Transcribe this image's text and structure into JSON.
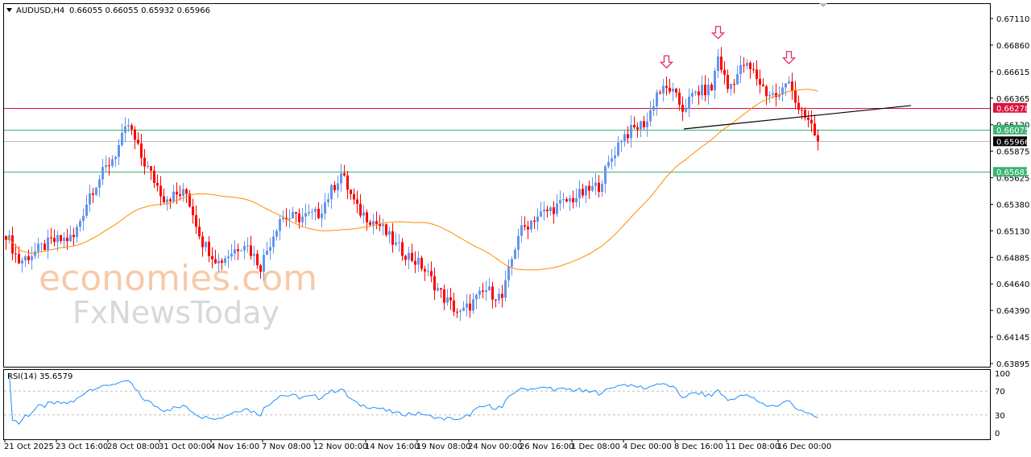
{
  "header": {
    "symbol": "AUDUSD,H4",
    "ohlc": "0.66055 0.66055 0.65932 0.65966"
  },
  "rsi": {
    "label": "RSI(14) 35.6579",
    "levels": [
      30,
      70
    ],
    "ticks": [
      "100",
      "70",
      "30",
      "0"
    ]
  },
  "watermark": {
    "line1": "economies.com",
    "line2": "FxNewsToday"
  },
  "colors": {
    "bull": "#6495ED",
    "bear": "#FF0000",
    "ma": "#FF8C00",
    "resistance": "#DC143C",
    "support": "#3CB371",
    "current": "#000000",
    "rsi": "#1E90FF"
  },
  "chart_data": {
    "type": "candlestick",
    "title": "AUDUSD,H4",
    "ylim": [
      0.63895,
      0.6711
    ],
    "y_ticks": [
      "0.67110",
      "0.66860",
      "0.66615",
      "0.66365",
      "0.66120",
      "0.65875",
      "0.65625",
      "0.65380",
      "0.65130",
      "0.64885",
      "0.64640",
      "0.64390",
      "0.64145",
      "0.63895"
    ],
    "x_ticks": [
      "21 Oct 2025",
      "23 Oct 16:00",
      "28 Oct 08:00",
      "31 Oct 00:00",
      "4 Nov 16:00",
      "7 Nov 08:00",
      "12 Nov 00:00",
      "14 Nov 16:00",
      "19 Nov 08:00",
      "24 Nov 00:00",
      "26 Nov 16:00",
      "1 Dec 08:00",
      "4 Dec 00:00",
      "8 Dec 16:00",
      "11 Dec 08:00",
      "16 Dec 00:00"
    ],
    "bars_per_tick": 16,
    "price_path": [
      [
        0,
        0.65105
      ],
      [
        4,
        0.64842
      ],
      [
        14,
        0.65029
      ],
      [
        21,
        0.65067
      ],
      [
        26,
        0.6548
      ],
      [
        34,
        0.65856
      ],
      [
        38,
        0.66119
      ],
      [
        42,
        0.65818
      ],
      [
        49,
        0.65443
      ],
      [
        56,
        0.6548
      ],
      [
        61,
        0.65029
      ],
      [
        66,
        0.64842
      ],
      [
        74,
        0.65029
      ],
      [
        79,
        0.64804
      ],
      [
        85,
        0.65255
      ],
      [
        91,
        0.65255
      ],
      [
        97,
        0.65292
      ],
      [
        104,
        0.65668
      ],
      [
        109,
        0.6533
      ],
      [
        116,
        0.6518
      ],
      [
        121,
        0.64992
      ],
      [
        129,
        0.64804
      ],
      [
        136,
        0.64504
      ],
      [
        141,
        0.64354
      ],
      [
        149,
        0.64579
      ],
      [
        154,
        0.64504
      ],
      [
        159,
        0.65105
      ],
      [
        164,
        0.65255
      ],
      [
        174,
        0.65405
      ],
      [
        184,
        0.65555
      ],
      [
        191,
        0.66006
      ],
      [
        199,
        0.66156
      ],
      [
        202,
        0.66419
      ],
      [
        206,
        0.66457
      ],
      [
        210,
        0.66269
      ],
      [
        214,
        0.66419
      ],
      [
        219,
        0.66457
      ],
      [
        221,
        0.66757
      ],
      [
        224,
        0.66457
      ],
      [
        229,
        0.66682
      ],
      [
        232,
        0.66607
      ],
      [
        236,
        0.66419
      ],
      [
        240,
        0.66381
      ],
      [
        243,
        0.66569
      ],
      [
        246,
        0.66231
      ],
      [
        249,
        0.66156
      ],
      [
        251,
        0.66043
      ],
      [
        252,
        0.65966
      ]
    ],
    "last_close": 0.65966,
    "moving_average": {
      "period": 50
    },
    "horizontal_levels": [
      {
        "price": 0.66278,
        "label": "0.66278",
        "kind": "resistance"
      },
      {
        "price": 0.66075,
        "label": "0.66075",
        "kind": "support"
      },
      {
        "price": 0.65966,
        "label": "0.65966",
        "kind": "current"
      },
      {
        "price": 0.65681,
        "label": "0.65681",
        "kind": "support"
      }
    ],
    "trendline": [
      [
        210.75,
        0.66081
      ],
      [
        281.25,
        0.66299
      ]
    ],
    "arrows_at_bars": [
      205,
      221,
      243
    ]
  }
}
